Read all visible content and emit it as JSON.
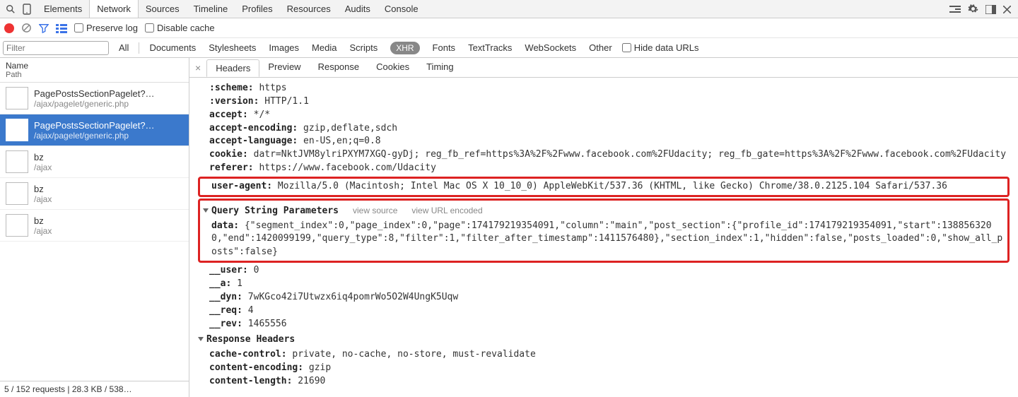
{
  "topTabs": [
    "Elements",
    "Network",
    "Sources",
    "Timeline",
    "Profiles",
    "Resources",
    "Audits",
    "Console"
  ],
  "topActiveIndex": 1,
  "toolbar": {
    "preserveLog": "Preserve log",
    "disableCache": "Disable cache"
  },
  "filter": {
    "placeholder": "Filter",
    "tabs": [
      "All",
      "Documents",
      "Stylesheets",
      "Images",
      "Media",
      "Scripts",
      "XHR",
      "Fonts",
      "TextTracks",
      "WebSockets",
      "Other"
    ],
    "activeIndex": 6,
    "hideData": "Hide data URLs"
  },
  "leftHeader": {
    "name": "Name",
    "path": "Path"
  },
  "requests": [
    {
      "name": "PagePostsSectionPagelet?…",
      "path": "/ajax/pagelet/generic.php"
    },
    {
      "name": "PagePostsSectionPagelet?…",
      "path": "/ajax/pagelet/generic.php"
    },
    {
      "name": "bz",
      "path": "/ajax"
    },
    {
      "name": "bz",
      "path": "/ajax"
    },
    {
      "name": "bz",
      "path": "/ajax"
    }
  ],
  "selectedIndex": 1,
  "status": "5 / 152 requests | 28.3 KB / 538…",
  "detailTabs": [
    "Headers",
    "Preview",
    "Response",
    "Cookies",
    "Timing"
  ],
  "detailActiveIndex": 0,
  "headersTop": [
    {
      "k": ":scheme:",
      "v": "https"
    },
    {
      "k": ":version:",
      "v": "HTTP/1.1"
    },
    {
      "k": "accept:",
      "v": "*/*"
    },
    {
      "k": "accept-encoding:",
      "v": "gzip,deflate,sdch"
    },
    {
      "k": "accept-language:",
      "v": "en-US,en;q=0.8"
    },
    {
      "k": "cookie:",
      "v": "datr=NktJVM8ylriPXYM7XGQ-gyDj; reg_fb_ref=https%3A%2F%2Fwww.facebook.com%2FUdacity; reg_fb_gate=https%3A%2F%2Fwww.facebook.com%2FUdacity"
    },
    {
      "k": "referer:",
      "v": "https://www.facebook.com/Udacity"
    }
  ],
  "userAgent": {
    "k": "user-agent:",
    "v": "Mozilla/5.0 (Macintosh; Intel Mac OS X 10_10_0) AppleWebKit/537.36 (KHTML, like Gecko) Chrome/38.0.2125.104 Safari/537.36"
  },
  "qsSection": {
    "title": "Query String Parameters",
    "viewSource": "view source",
    "viewEncoded": "view URL encoded"
  },
  "qsData": {
    "k": "data:",
    "v": "{\"segment_index\":0,\"page_index\":0,\"page\":174179219354091,\"column\":\"main\",\"post_section\":{\"profile_id\":174179219354091,\"start\":1388563200,\"end\":1420099199,\"query_type\":8,\"filter\":1,\"filter_after_timestamp\":1411576480},\"section_index\":1,\"hidden\":false,\"posts_loaded\":0,\"show_all_posts\":false}"
  },
  "qsRest": [
    {
      "k": "__user:",
      "v": "0"
    },
    {
      "k": "__a:",
      "v": "1"
    },
    {
      "k": "__dyn:",
      "v": "7wKGco42i7Utwzx6iq4pomrWo5O2W4UngK5Uqw"
    },
    {
      "k": "__req:",
      "v": "4"
    },
    {
      "k": "__rev:",
      "v": "1465556"
    }
  ],
  "respSection": {
    "title": "Response Headers"
  },
  "respHeaders": [
    {
      "k": "cache-control:",
      "v": "private, no-cache, no-store, must-revalidate"
    },
    {
      "k": "content-encoding:",
      "v": "gzip"
    },
    {
      "k": "content-length:",
      "v": "21690"
    }
  ]
}
